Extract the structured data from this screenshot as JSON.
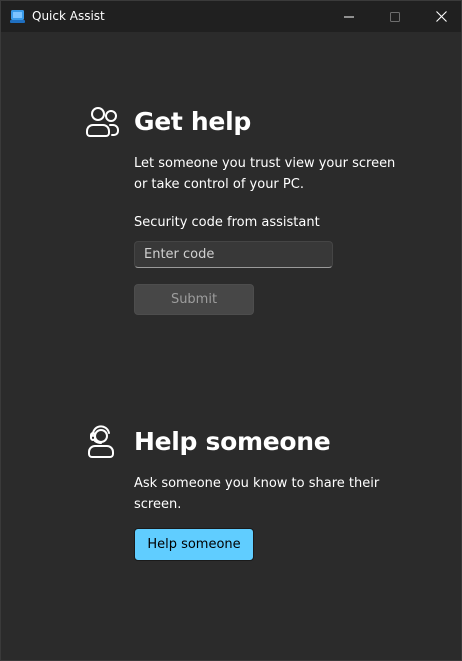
{
  "window": {
    "title": "Quick Assist",
    "icons": {
      "app": "quick-assist-icon",
      "minimize": "minimize-icon",
      "maximize": "maximize-icon",
      "close": "close-icon"
    }
  },
  "get_help": {
    "icon": "people-icon",
    "heading": "Get help",
    "description": "Let someone you trust view your screen or take control of your PC.",
    "code_label": "Security code from assistant",
    "code_placeholder": "Enter code",
    "code_value": "",
    "submit_label": "Submit"
  },
  "help_someone": {
    "icon": "person-headset-icon",
    "heading": "Help someone",
    "description": "Ask someone you know to share their screen.",
    "button_label": "Help someone"
  },
  "colors": {
    "window_background": "#2b2b2b",
    "titlebar_background": "#202020",
    "accent": "#60cdff",
    "disabled_button": "#474747",
    "disabled_text": "#9d9d9d"
  }
}
